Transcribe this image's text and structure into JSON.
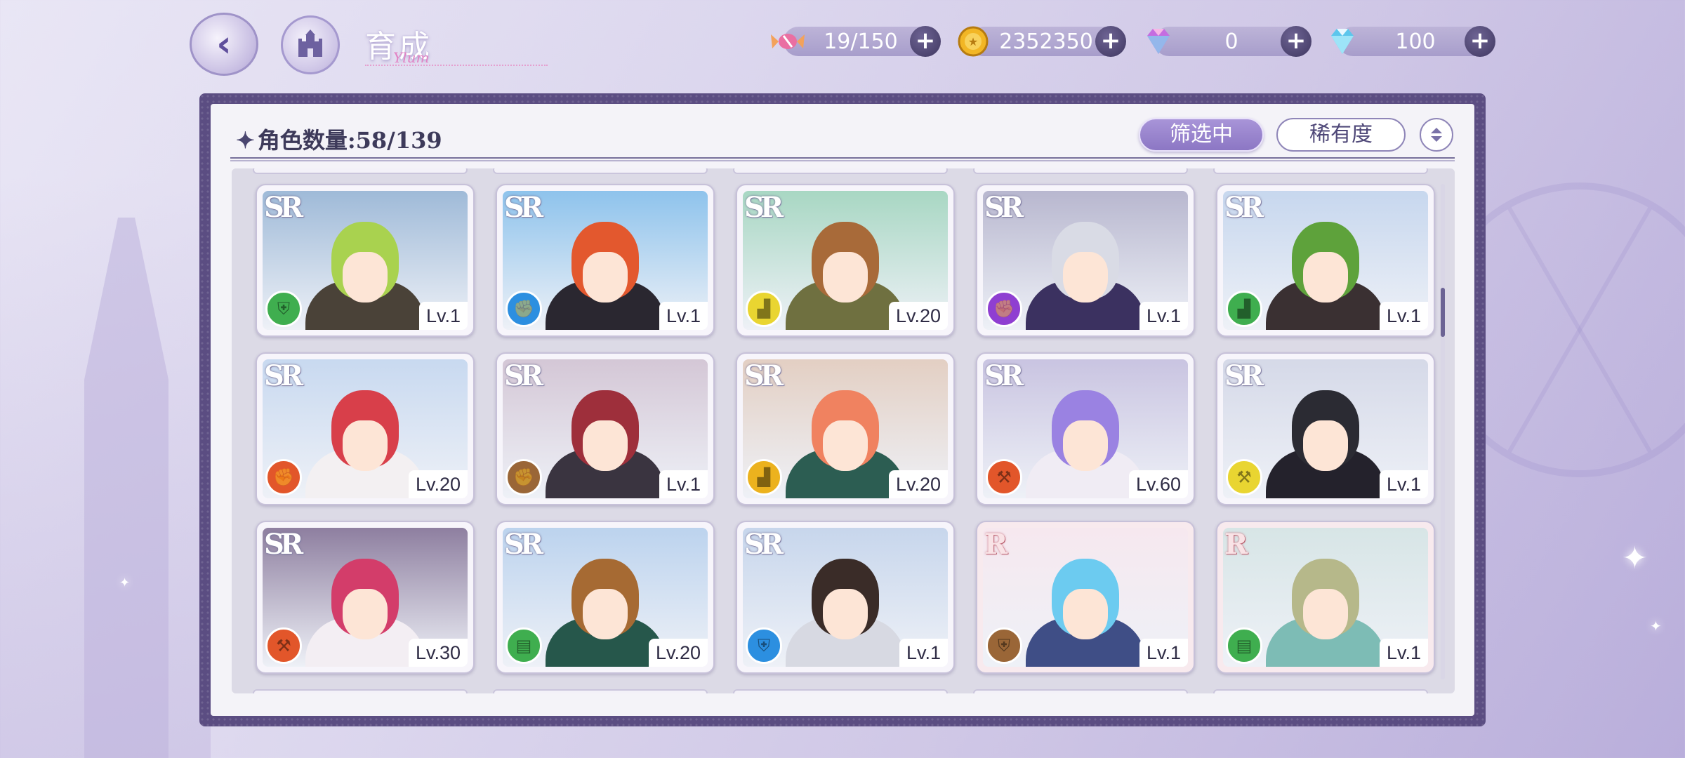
{
  "header": {
    "title": "育成",
    "title_sub": "Ylum",
    "resources": [
      {
        "name": "candy",
        "value": "19/150",
        "icon": "candy-icon",
        "color": "#ea6fa2"
      },
      {
        "name": "gold",
        "value": "2352350",
        "icon": "coin-icon",
        "color": "#f2b625"
      },
      {
        "name": "gem",
        "value": "0",
        "icon": "gem-icon",
        "color": "#c56ce0"
      },
      {
        "name": "diamond",
        "value": "100",
        "icon": "diamond-icon",
        "color": "#5cc6ec"
      }
    ]
  },
  "panel": {
    "count_label": "角色数量:",
    "count_value": "58/139",
    "filter_label": "筛选中",
    "rarity_label": "稀有度"
  },
  "cards": [
    {
      "rarity": "SR",
      "level": "Lv.1",
      "role_color": "#3fae4f",
      "role_icon": "shield-icon",
      "hair": "#a9d24f",
      "outfit": "#4a4238",
      "bg": "#9fbad8"
    },
    {
      "rarity": "SR",
      "level": "Lv.1",
      "role_color": "#2c8fe0",
      "role_icon": "fist-icon",
      "hair": "#e3582e",
      "outfit": "#2a2730",
      "bg": "#8ec3ec"
    },
    {
      "rarity": "SR",
      "level": "Lv.20",
      "role_color": "#e9d531",
      "role_icon": "boot-icon",
      "hair": "#a86a39",
      "outfit": "#6f7040",
      "bg": "#a8d7c3"
    },
    {
      "rarity": "SR",
      "level": "Lv.1",
      "role_color": "#8f3fd1",
      "role_icon": "fist-icon",
      "hair": "#d9dbe5",
      "outfit": "#3b3160",
      "bg": "#b8b7cf"
    },
    {
      "rarity": "SR",
      "level": "Lv.1",
      "role_color": "#3fae4f",
      "role_icon": "boot-icon",
      "hair": "#5ea23b",
      "outfit": "#3a3032",
      "bg": "#c7d7ee"
    },
    {
      "rarity": "SR",
      "level": "Lv.20",
      "role_color": "#e2562a",
      "role_icon": "fist-icon",
      "hair": "#d83f4a",
      "outfit": "#f3f0f2",
      "bg": "#c8d9f0"
    },
    {
      "rarity": "SR",
      "level": "Lv.1",
      "role_color": "#9a6637",
      "role_icon": "fist-icon",
      "hair": "#9e2f3b",
      "outfit": "#3a3440",
      "bg": "#d4c7d6"
    },
    {
      "rarity": "SR",
      "level": "Lv.20",
      "role_color": "#ecb21e",
      "role_icon": "boot-icon",
      "hair": "#f08260",
      "outfit": "#2c5d52",
      "bg": "#e3cfc3"
    },
    {
      "rarity": "SR",
      "level": "Lv.60",
      "role_color": "#e2562a",
      "role_icon": "hammer-icon",
      "hair": "#9a82e2",
      "outfit": "#f0ecf4",
      "bg": "#c9c4e1"
    },
    {
      "rarity": "SR",
      "level": "Lv.1",
      "role_color": "#e9d531",
      "role_icon": "hammer-icon",
      "hair": "#2b2b33",
      "outfit": "#24222c",
      "bg": "#d5d9e8"
    },
    {
      "rarity": "SR",
      "level": "Lv.30",
      "role_color": "#e2562a",
      "role_icon": "hammer-icon",
      "hair": "#d33d6a",
      "outfit": "#f3eef3",
      "bg": "#8e7fa0"
    },
    {
      "rarity": "SR",
      "level": "Lv.20",
      "role_color": "#3fae4f",
      "role_icon": "book-icon",
      "hair": "#a66a33",
      "outfit": "#26574b",
      "bg": "#bcd3ee"
    },
    {
      "rarity": "SR",
      "level": "Lv.1",
      "role_color": "#2c8fe0",
      "role_icon": "shield-icon",
      "hair": "#3a2c28",
      "outfit": "#d7d9e2",
      "bg": "#c7d6ec"
    },
    {
      "rarity": "R",
      "level": "Lv.1",
      "role_color": "#9a6637",
      "role_icon": "shield-icon",
      "hair": "#6ccbf0",
      "outfit": "#3f4e86",
      "bg": "#f6e8ef"
    },
    {
      "rarity": "R",
      "level": "Lv.1",
      "role_color": "#3fae4f",
      "role_icon": "book-icon",
      "hair": "#b6b88a",
      "outfit": "#7dbcb5",
      "bg": "#d7e5e6"
    }
  ]
}
